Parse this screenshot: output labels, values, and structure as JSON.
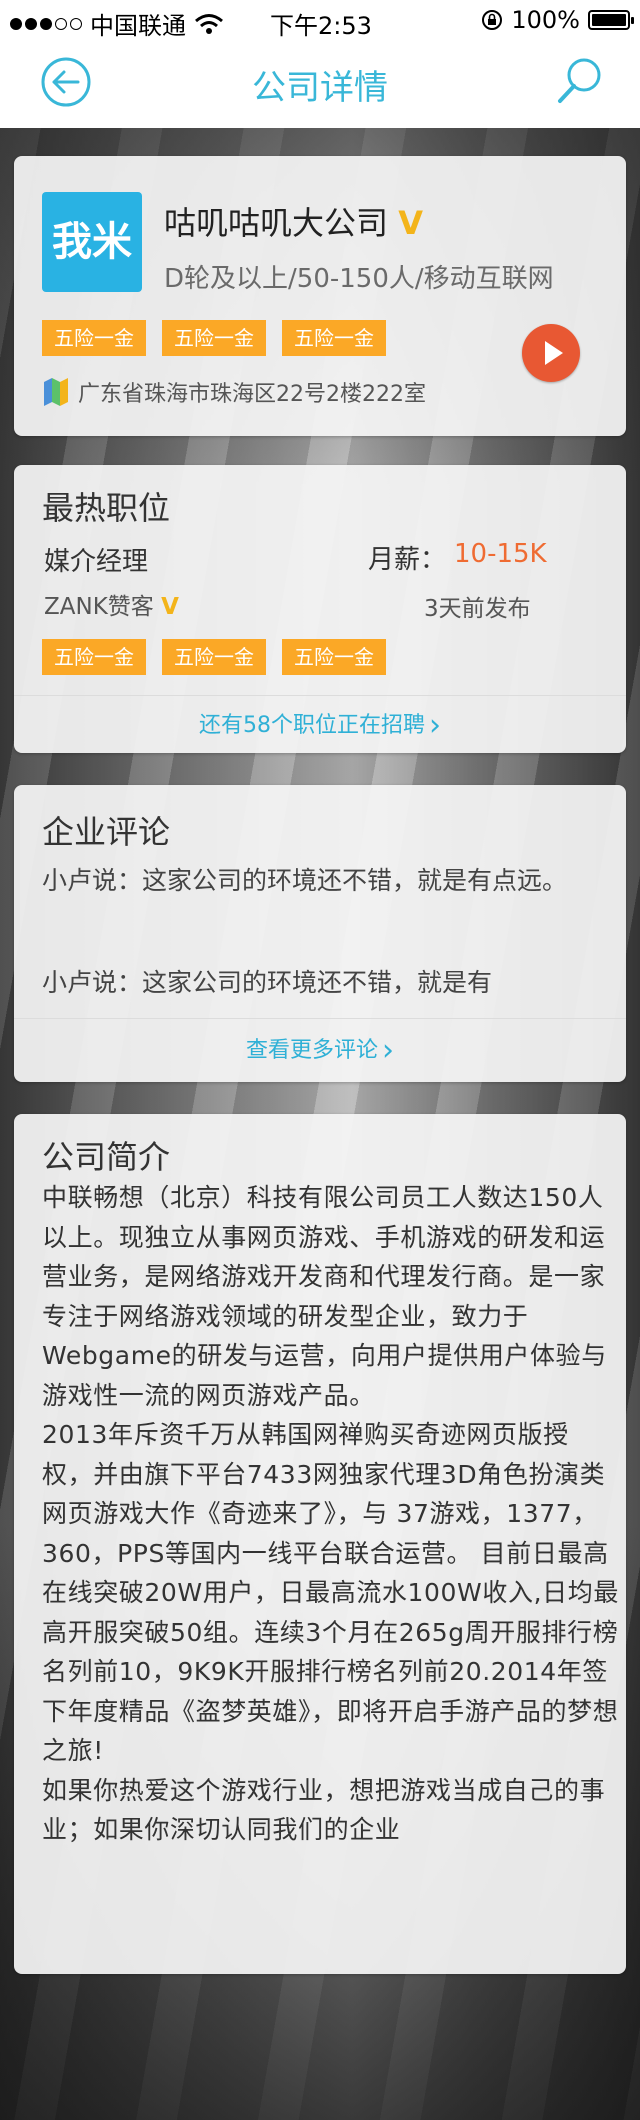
{
  "status_bar": {
    "carrier": "中国联通",
    "time": "下午2:53",
    "battery": "100%"
  },
  "nav": {
    "title": "公司详情",
    "back_icon": "back-arrow-circle-icon",
    "search_icon": "search-icon"
  },
  "company": {
    "logo_text": "我米",
    "name": "咕叽咕叽大公司",
    "verified": "V",
    "meta": "D轮及以上/50-150人/移动互联网",
    "tags": [
      "五险一金",
      "五险一金",
      "五险一金"
    ],
    "address": "广东省珠海市珠海区22号2楼222室",
    "colors": {
      "tag": "#fba826",
      "accent": "#39b7d8",
      "play": "#e85833",
      "logo": "#29b2e3"
    }
  },
  "hot_jobs": {
    "title": "最热职位",
    "job_title": "媒介经理",
    "salary_label": "月薪：",
    "salary_value": "10-15K",
    "company": "ZANK赞客",
    "verified": "V",
    "posted": "3天前发布",
    "tags": [
      "五险一金",
      "五险一金",
      "五险一金"
    ],
    "more": "还有58个职位正在招聘"
  },
  "reviews": {
    "title": "企业评论",
    "items": [
      "小卢说：这家公司的环境还不错，就是有点远。",
      "小卢说：这家公司的环境还不错，就是有"
    ],
    "more": "查看更多评论"
  },
  "intro": {
    "title": "公司简介",
    "paragraphs": [
      "中联畅想（北京）科技有限公司员工人数达150人以上。现独立从事网页游戏、手机游戏的研发和运营业务，是网络游戏开发商和代理发行商。是一家专注于网络游戏领域的研发型企业，致力于Webgame的研发与运营，向用户提供用户体验与游戏性一流的网页游戏产品。",
      "2013年斥资千万从韩国网禅购买奇迹网页版授权，并由旗下平台7433网独家代理3D角色扮演类网页游戏大作《奇迹来了》，与 37游戏，1377，360，PPS等国内一线平台联合运营。 目前日最高在线突破20W用户，日最高流水100W收入,日均最高开服突破50组。连续3个月在265g周开服排行榜名列前10，9K9K开服排行榜名列前20.2014年签下年度精品《盗梦英雄》，即将开启手游产品的梦想之旅!",
      "如果你热爱这个游戏行业，想把游戏当成自己的事业；如果你深切认同我们的企业"
    ]
  }
}
